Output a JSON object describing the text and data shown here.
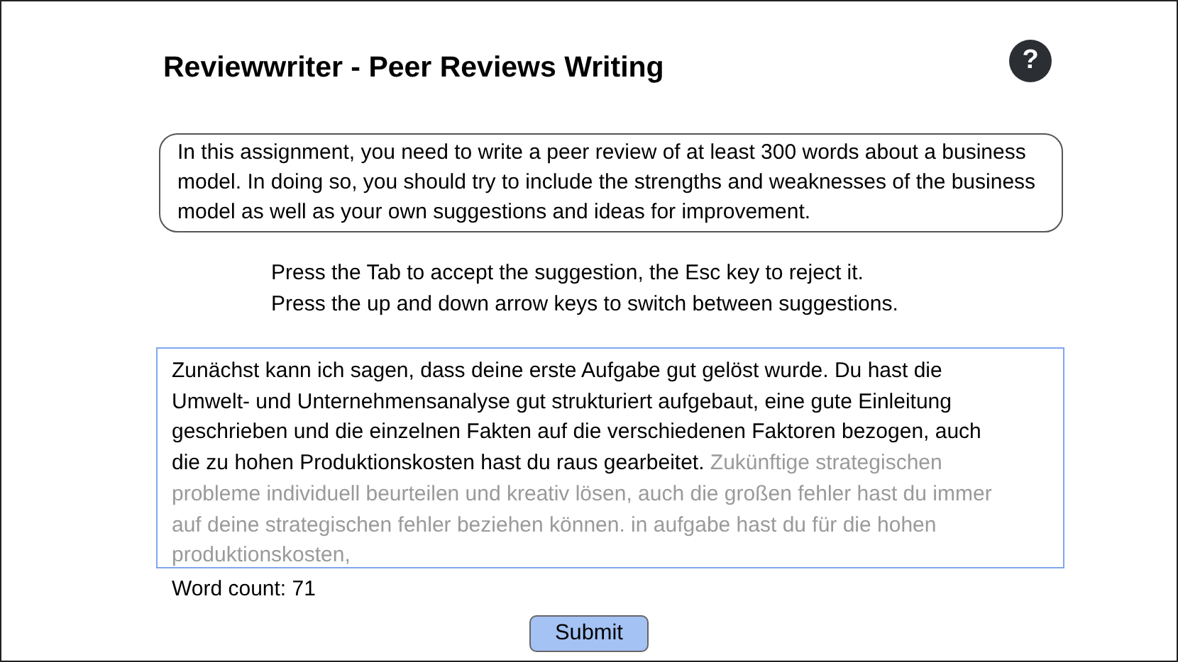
{
  "header": {
    "title": "Reviewwriter - Peer Reviews Writing",
    "help_button": "?"
  },
  "assignment": "In this assignment, you need to write a peer review of at least 300 words about a business model. In doing so, you should try to include the strengths and weaknesses of the business model as well as your own suggestions and ideas for improvement.",
  "hints": [
    "Press the Tab to accept the suggestion, the Esc key to reject it.",
    "Press the up and down arrow keys to switch between suggestions."
  ],
  "editor_lines": [
    [
      {
        "kind": "typed",
        "text": "Zunächst kann ich sagen, dass deine erste Aufgabe gut gelöst wurde. Du hast die"
      }
    ],
    [
      {
        "kind": "typed",
        "text": "Umwelt- und Unternehmensanalyse gut strukturiert aufgebaut, eine gute Einleitung"
      }
    ],
    [
      {
        "kind": "typed",
        "text": "geschrieben und die einzelnen Fakten auf die verschiedenen Faktoren bezogen, auch"
      }
    ],
    [
      {
        "kind": "typed",
        "text": "die zu hohen Produktionskosten hast du raus gearbeitet."
      },
      {
        "kind": "suggestion",
        "text": "Zukünftige strategischen"
      }
    ],
    [
      {
        "kind": "suggestion",
        "text": "probleme individuell beurteilen und kreativ lösen, auch die großen fehler hast du immer"
      }
    ],
    [
      {
        "kind": "suggestion",
        "text": "auf deine strategischen fehler beziehen können. in aufgabe hast du für die hohen"
      }
    ],
    [
      {
        "kind": "suggestion",
        "text": "produktionskosten,"
      }
    ]
  ],
  "word_count": "Word count: 71",
  "submit_button": "Submit"
}
